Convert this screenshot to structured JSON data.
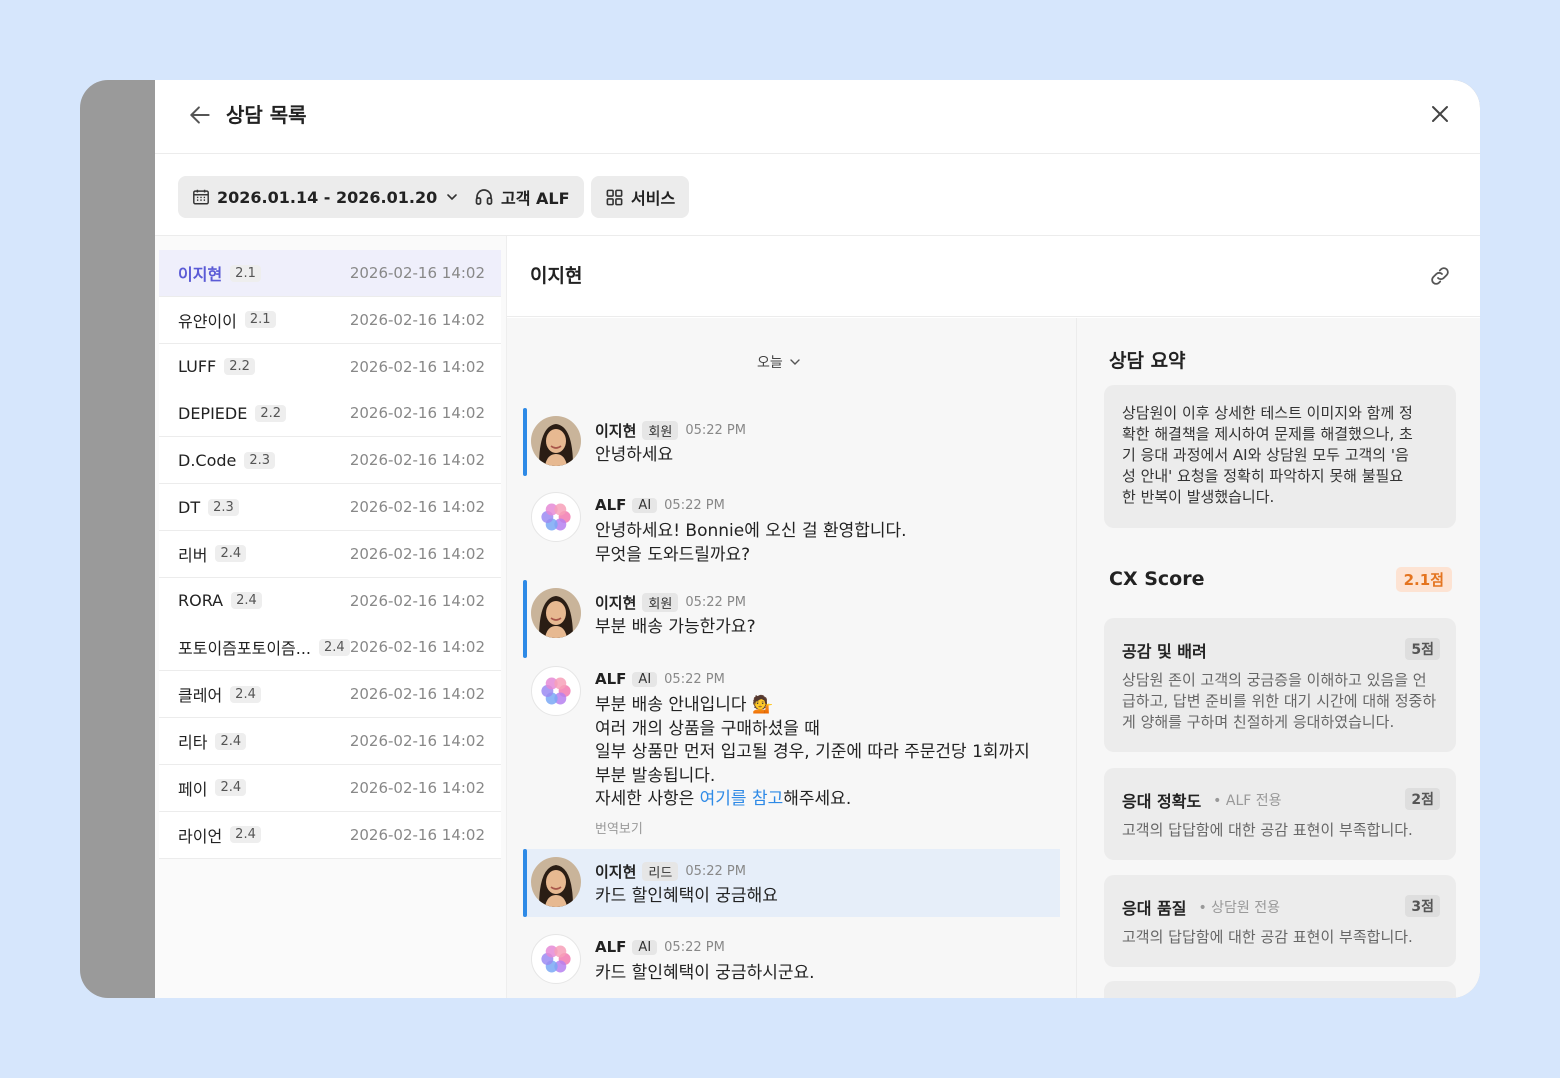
{
  "header": {
    "title": "상담 목록"
  },
  "filters": {
    "date_range": "2026.01.14 - 2026.01.20",
    "customer": "고객 ALF",
    "service": "서비스"
  },
  "list": [
    {
      "name": "이지현",
      "score": "2.1",
      "date": "2026-02-16 14:02",
      "active": true
    },
    {
      "name": "유얀이이",
      "score": "2.1",
      "date": "2026-02-16 14:02"
    },
    {
      "name": "LUFF",
      "score": "2.2",
      "date": "2026-02-16 14:02"
    },
    {
      "name": "DEPIEDE",
      "score": "2.2",
      "date": "2026-02-16 14:02"
    },
    {
      "name": "D.Code",
      "score": "2.3",
      "date": "2026-02-16 14:02"
    },
    {
      "name": "DT",
      "score": "2.3",
      "date": "2026-02-16 14:02"
    },
    {
      "name": "리버",
      "score": "2.4",
      "date": "2026-02-16 14:02"
    },
    {
      "name": "RORA",
      "score": "2.4",
      "date": "2026-02-16 14:02"
    },
    {
      "name": "포토이즘포토이즘...",
      "score": "2.4",
      "date": "2026-02-16 14:02"
    },
    {
      "name": "클레어",
      "score": "2.4",
      "date": "2026-02-16 14:02"
    },
    {
      "name": "리타",
      "score": "2.4",
      "date": "2026-02-16 14:02"
    },
    {
      "name": "페이",
      "score": "2.4",
      "date": "2026-02-16 14:02"
    },
    {
      "name": "라이언",
      "score": "2.4",
      "date": "2026-02-16 14:02"
    }
  ],
  "chat": {
    "customer_name": "이지현",
    "day_label": "오늘",
    "messages": [
      {
        "who": "이지현",
        "tag": "회원",
        "time": "05:22 PM",
        "lines": [
          "안녕하세요"
        ]
      },
      {
        "who": "ALF",
        "tag": "AI",
        "time": "05:22 PM",
        "lines": [
          "안녕하세요! Bonnie에 오신 걸 환영합니다.",
          "무엇을 도와드릴까요?"
        ]
      },
      {
        "who": "이지현",
        "tag": "회원",
        "time": "05:22 PM",
        "lines": [
          "부분 배송 가능한가요?"
        ]
      },
      {
        "who": "ALF",
        "tag": "AI",
        "time": "05:22 PM",
        "lines": [
          "부분 배송 안내입니다 💁",
          "여러 개의 상품을 구매하셨을 때",
          "일부 상품만 먼저 입고될 경우, 기준에 따라 주문건당 1회까지",
          "부분 발송됩니다."
        ],
        "last_pre": "자세한 사항은 ",
        "last_link": "여기를 참고",
        "last_post": "해주세요.",
        "translate": "번역보기"
      },
      {
        "who": "이지현",
        "tag": "리드",
        "time": "05:22 PM",
        "lines": [
          "카드 할인혜택이 궁금해요"
        ]
      },
      {
        "who": "ALF",
        "tag": "AI",
        "time": "05:22 PM",
        "lines": [
          "카드 할인혜택이 궁금하시군요."
        ]
      }
    ]
  },
  "side": {
    "summary_title": "상담 요약",
    "summary_lines": [
      "상담원이 이후 상세한 테스트 이미지와 함께 정",
      "확한 해결책을 제시하여 문제를 해결했으나, 초",
      "기 응대 과정에서 AI와 상담원 모두 고객의 '음",
      "성 안내' 요청을 정확히 파악하지 못해 불필요",
      "한 반복이 발생했습니다."
    ],
    "cx_title": "CX Score",
    "cx_score": "2.1점",
    "cards": [
      {
        "title": "공감 및 배려",
        "note": "",
        "score": "5점",
        "desc_lines": [
          "상담원 존이 고객의 궁금증을 이해하고 있음을 언",
          "급하고, 답변 준비를 위한 대기 시간에 대해 정중하",
          "게 양해를 구하며 친절하게 응대하였습니다."
        ]
      },
      {
        "title": "응대 정확도",
        "note": "• ALF 전용",
        "score": "2점",
        "desc_lines": [
          "고객의 답답함에 대한 공감 표현이 부족합니다."
        ]
      },
      {
        "title": "응대 품질",
        "note": "• 상담원 전용",
        "score": "3점",
        "desc_lines": [
          "고객의 답답함에 대한 공감 표현이 부족합니다."
        ]
      }
    ]
  },
  "colors": {
    "accent": "#5b5bd6",
    "user_bar": "#2e8ae6",
    "score": "#e4741f"
  }
}
